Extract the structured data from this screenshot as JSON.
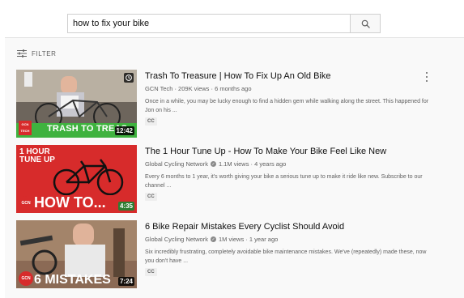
{
  "search": {
    "query": "how to fix your bike"
  },
  "filter": {
    "label": "FILTER"
  },
  "videos": [
    {
      "title": "Trash To Treasure | How To Fix Up An Old Bike",
      "channel": "GCN Tech",
      "stats": "· 209K views · 6 months ago",
      "description": "Once in a while, you may be lucky enough to find a hidden gem while walking along the street. This happened for Jon on his ...",
      "badge": "CC",
      "duration": "12:42",
      "thumb_text": "TRASH TO TREAS",
      "logo": "GCN TECH"
    },
    {
      "title": "The 1 Hour Tune Up - How To Make Your Bike Feel Like New",
      "channel": "Global Cycling Network",
      "stats": "1.1M views · 4 years ago",
      "description": "Every 6 months to 1 year, it's worth giving your bike a serious tune up to make it ride like new. Subscribe to our channel ...",
      "badge": "CC",
      "duration": "4:35",
      "thumb_text_top_1": "1 HOUR",
      "thumb_text_top_2": "TUNE UP",
      "thumb_text": "HOW TO...",
      "logo": "GCN"
    },
    {
      "title": "6 Bike Repair Mistakes Every Cyclist Should Avoid",
      "channel": "Global Cycling Network",
      "stats": "1M views · 1 year ago",
      "description": "Six incredibly frustrating, completely avoidable bike maintenance mistakes. We've (repeatedly) made these, now you don't have ...",
      "badge": "CC",
      "duration": "7:24",
      "thumb_text": "6 MISTAKES",
      "logo": "GCN"
    }
  ],
  "colors": {
    "gcn_red": "#d72b2b",
    "green_banner": "#3fb23f",
    "text_secondary": "#606060"
  }
}
